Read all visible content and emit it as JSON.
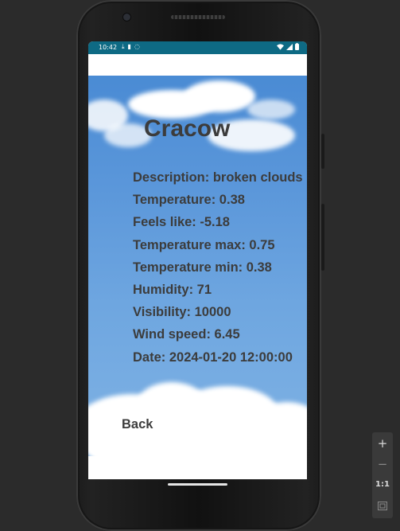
{
  "status_bar": {
    "time": "10:42",
    "left_icons": [
      "download-icon",
      "lock-icon",
      "sync-icon"
    ],
    "right_icons": [
      "wifi-icon",
      "signal-icon",
      "battery-icon"
    ],
    "color": "#0e6a84"
  },
  "weather": {
    "city": "Cracow",
    "description": "Description: broken clouds",
    "temperature": "Temperature: 0.38",
    "feels_like": "Feels like: -5.18",
    "temp_max": "Temperature max: 0.75",
    "temp_min": "Temperature min: 0.38",
    "humidity": "Humidity: 71",
    "visibility": "Visibility: 10000",
    "wind_speed": "Wind speed: 6.45",
    "date": "Date: 2024-01-20 12:00:00"
  },
  "back_label": "Back",
  "sky_color": "#5b97da",
  "text_color": "#3c3c3c",
  "zoom_controls": {
    "zoom_in": "+",
    "zoom_out": "−",
    "actual_size": "1:1"
  }
}
